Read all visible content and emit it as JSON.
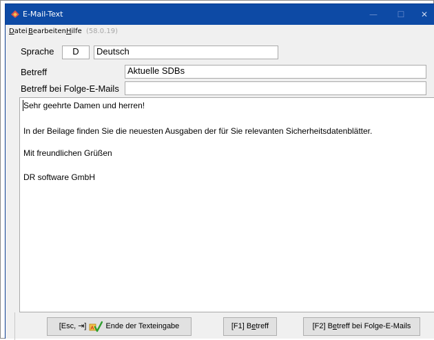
{
  "window": {
    "title": "E-Mail-Text",
    "controls": {
      "minimize": "—",
      "maximize": "☐",
      "close": "✕"
    }
  },
  "menu": {
    "datei": {
      "acc": "D",
      "rest": "atei"
    },
    "bearbeiten": {
      "acc": "B",
      "rest": "earbeiten"
    },
    "hilfe": {
      "acc": "H",
      "rest": "ilfe"
    },
    "version": "(58.0.19)"
  },
  "form": {
    "sprache_label": "Sprache",
    "sprache_code": "D",
    "sprache_name": "Deutsch",
    "betreff_label": "Betreff",
    "betreff_value": "Aktuelle SDBs",
    "folge_label": "Betreff bei Folge-E-Mails",
    "folge_value": ""
  },
  "body": {
    "lines": [
      "Sehr geehrte Damen und herren!",
      "In der Beilage finden Sie die neuesten Ausgaben der für Sie relevanten Sicherheitsdatenblätter.",
      "Mit freundlichen Grüßen",
      "DR software GmbH"
    ]
  },
  "buttons": {
    "esc_prefix": "[Esc, ⇥]",
    "esc_label": "Ende der Texteingabe",
    "esc_icon": "confirm-checkmark-icon",
    "f1_prefix": "[F1] B",
    "f1_acc": "e",
    "f1_rest": "treff",
    "f2_prefix": "[F2] B",
    "f2_acc": "e",
    "f2_rest": "treff bei Folge-E-Mails"
  },
  "colors": {
    "titlebar": "#0d4aa5",
    "window_bg": "#f0f0f0",
    "button_bg": "#e1e1e1"
  }
}
